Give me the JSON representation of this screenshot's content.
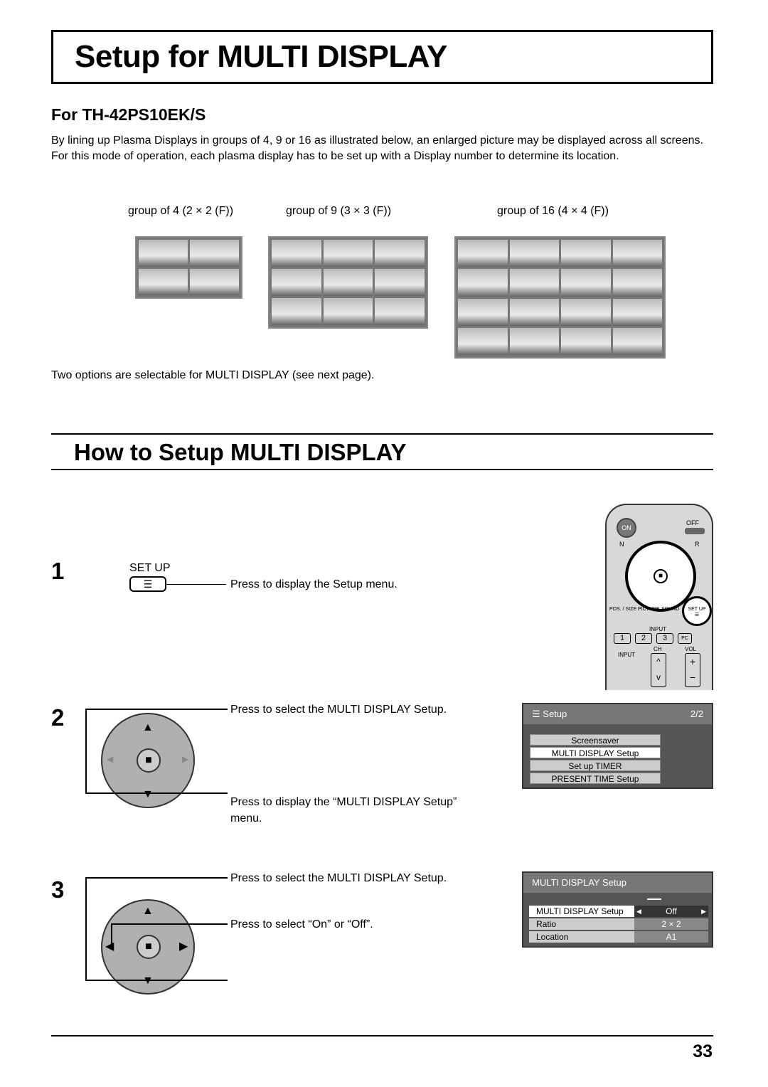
{
  "title": "Setup for MULTI DISPLAY",
  "subtitle": "For TH-42PS10EK/S",
  "intro": [
    "By lining up Plasma Displays in groups of 4, 9 or 16 as illustrated below, an enlarged picture may be displayed across all screens.",
    "For this mode of operation, each plasma display has to be set up with a Display number to determine its location."
  ],
  "groups": [
    "group of 4 (2 × 2 (F))",
    "group of 9 (3 × 3 (F))",
    "group of 16 (4 × 4 (F))"
  ],
  "caption": "Two options are selectable for MULTI DISPLAY (see next page).",
  "section_title": "How to Setup MULTI DISPLAY",
  "steps": [
    {
      "num": "1",
      "button_label": "SET UP",
      "text": "Press to display the Setup menu."
    },
    {
      "num": "2",
      "text_a": "Press to select the MULTI DISPLAY Setup.",
      "text_b": "Press to display the “MULTI DISPLAY Setup” menu."
    },
    {
      "num": "3",
      "text_a": "Press to select the MULTI DISPLAY Setup.",
      "text_b": "Press to select “On” or “Off”."
    }
  ],
  "remote": {
    "on": "ON",
    "off": "OFF",
    "n": "N",
    "r": "R",
    "pos_size": "POS. / SIZE",
    "picture": "PICTURE",
    "sound": "SOUND",
    "setup": "SET UP",
    "input_group": "INPUT",
    "inputs": [
      "1",
      "2",
      "3",
      "PC"
    ],
    "input": "INPUT",
    "ch": "CH",
    "vol": "VOL"
  },
  "setup_menu": {
    "title": "Setup",
    "page": "2/2",
    "items": [
      "Screensaver",
      "MULTI DISPLAY Setup",
      "Set up TIMER",
      "PRESENT TIME Setup"
    ],
    "selected": 1
  },
  "multi_menu": {
    "title": "MULTI DISPLAY Setup",
    "rows": [
      {
        "label": "MULTI DISPLAY Setup",
        "value": "Off"
      },
      {
        "label": "Ratio",
        "value": "2 × 2"
      },
      {
        "label": "Location",
        "value": "A1"
      }
    ]
  },
  "page_number": "33"
}
